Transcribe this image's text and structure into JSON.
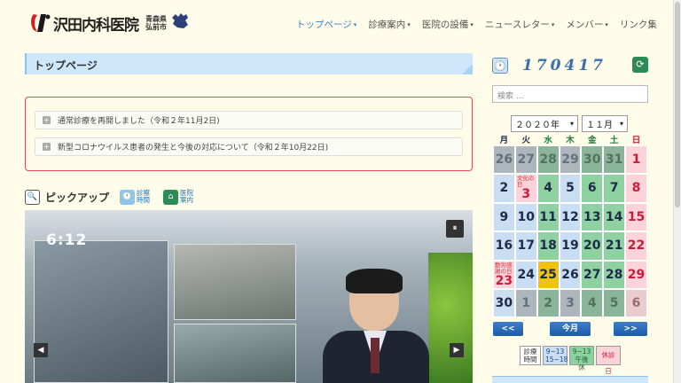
{
  "header": {
    "logo_text": "沢田内科医院",
    "logo_loc_line1": "青森県",
    "logo_loc_line2": "弘前市",
    "nav": [
      {
        "label": "トップページ",
        "caret": true,
        "active": true
      },
      {
        "label": "診療案内",
        "caret": true
      },
      {
        "label": "医院の設備",
        "caret": true
      },
      {
        "label": "ニュースレター",
        "caret": true
      },
      {
        "label": "メンバー",
        "caret": true
      },
      {
        "label": "リンク集",
        "caret": false
      }
    ]
  },
  "main": {
    "page_title": "トップページ",
    "news": [
      "通常診療を再開しました（令和２年11月2日)",
      "新型コロナウイルス患者の発生と今後の対応について（令和２年10月22日)"
    ],
    "pickup": {
      "title": "ピックアップ",
      "sub1": "診察時間",
      "sub2": "医院案内"
    },
    "video": {
      "time": "6:12",
      "pause": "⏸",
      "prev": "◀",
      "next": "▶"
    }
  },
  "sidebar": {
    "counter": "170417",
    "search_placeholder": "検索 ...",
    "year_select": "２０２０年",
    "month_select": "１１月",
    "dows": [
      "月",
      "火",
      "水",
      "木",
      "金",
      "土",
      "日"
    ],
    "dow_colors": [
      "#1d2a48",
      "#1d2a48",
      "#1e7a3e",
      "#1e7a3e",
      "#1e7a3e",
      "#1e7a3e",
      "#cc1b3a"
    ],
    "cells": [
      {
        "d": "26",
        "c": "c-out"
      },
      {
        "d": "27",
        "c": "c-out"
      },
      {
        "d": "28",
        "c": "c-outg"
      },
      {
        "d": "29",
        "c": "c-out"
      },
      {
        "d": "30",
        "c": "c-outg"
      },
      {
        "d": "31",
        "c": "c-outg"
      },
      {
        "d": "1",
        "c": "c-pink"
      },
      {
        "d": "2",
        "c": "c-blue"
      },
      {
        "d": "3",
        "c": "c-pink",
        "note": "文化の日"
      },
      {
        "d": "4",
        "c": "c-green"
      },
      {
        "d": "5",
        "c": "c-blue"
      },
      {
        "d": "6",
        "c": "c-green"
      },
      {
        "d": "7",
        "c": "c-green"
      },
      {
        "d": "8",
        "c": "c-pink"
      },
      {
        "d": "9",
        "c": "c-blue"
      },
      {
        "d": "10",
        "c": "c-blue"
      },
      {
        "d": "11",
        "c": "c-green"
      },
      {
        "d": "12",
        "c": "c-blue"
      },
      {
        "d": "13",
        "c": "c-green"
      },
      {
        "d": "14",
        "c": "c-green"
      },
      {
        "d": "15",
        "c": "c-pink"
      },
      {
        "d": "16",
        "c": "c-blue"
      },
      {
        "d": "17",
        "c": "c-blue"
      },
      {
        "d": "18",
        "c": "c-green"
      },
      {
        "d": "19",
        "c": "c-blue"
      },
      {
        "d": "20",
        "c": "c-green"
      },
      {
        "d": "21",
        "c": "c-green"
      },
      {
        "d": "22",
        "c": "c-pink"
      },
      {
        "d": "23",
        "c": "c-pink",
        "note": "勤労感謝の日"
      },
      {
        "d": "24",
        "c": "c-blue"
      },
      {
        "d": "25",
        "c": "c-yellow"
      },
      {
        "d": "26",
        "c": "c-blue"
      },
      {
        "d": "27",
        "c": "c-green"
      },
      {
        "d": "28",
        "c": "c-green"
      },
      {
        "d": "29",
        "c": "c-pink"
      },
      {
        "d": "30",
        "c": "c-blue"
      },
      {
        "d": "1",
        "c": "c-out"
      },
      {
        "d": "2",
        "c": "c-outg"
      },
      {
        "d": "3",
        "c": "c-out"
      },
      {
        "d": "4",
        "c": "c-outg"
      },
      {
        "d": "5",
        "c": "c-outg"
      },
      {
        "d": "6",
        "c": "c-outp"
      }
    ],
    "nav_prev": "<<",
    "nav_today": "今月",
    "nav_next": ">>",
    "legend": {
      "l1": "診療時間",
      "l2": "9~13 15~18",
      "l3": "9~13 午後休",
      "l4": "休診日"
    }
  }
}
